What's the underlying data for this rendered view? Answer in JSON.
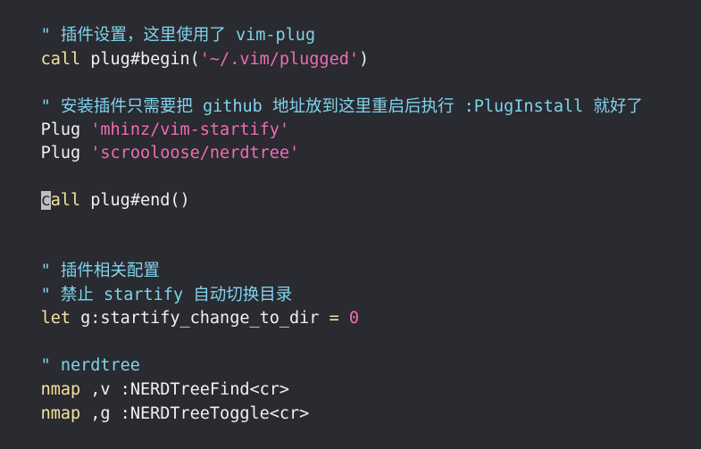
{
  "editor": {
    "lines": {
      "l1": {
        "comment": "\" 插件设置，这里使用了 vim-plug"
      },
      "l2": {
        "keyword": "call",
        "text": " plug#begin(",
        "string": "'~/.vim/plugged'",
        "tail": ")"
      },
      "l3": {
        "comment": "\" 安装插件只需要把 github 地址放到这里重启后执行 :PlugInstall 就好了"
      },
      "l4": {
        "cmd": "Plug ",
        "string": "'mhinz/vim-startify'"
      },
      "l5": {
        "cmd": "Plug ",
        "string": "'scrooloose/nerdtree'"
      },
      "l6": {
        "cursor_char": "c",
        "keyword_rest": "all",
        "text": " plug#end()"
      },
      "l7": {
        "comment": "\" 插件相关配置"
      },
      "l8": {
        "comment": "\" 禁止 startify 自动切换目录"
      },
      "l9": {
        "keyword": "let",
        "text": " g:startify_change_to_dir ",
        "op": "=",
        "space": " ",
        "number": "0"
      },
      "l10": {
        "comment": "\" nerdtree"
      },
      "l11": {
        "keyword": "nmap",
        "text": " ,v :NERDTreeFind<cr>"
      },
      "l12": {
        "keyword": "nmap",
        "text": " ,g :NERDTreeToggle<cr>"
      }
    }
  }
}
